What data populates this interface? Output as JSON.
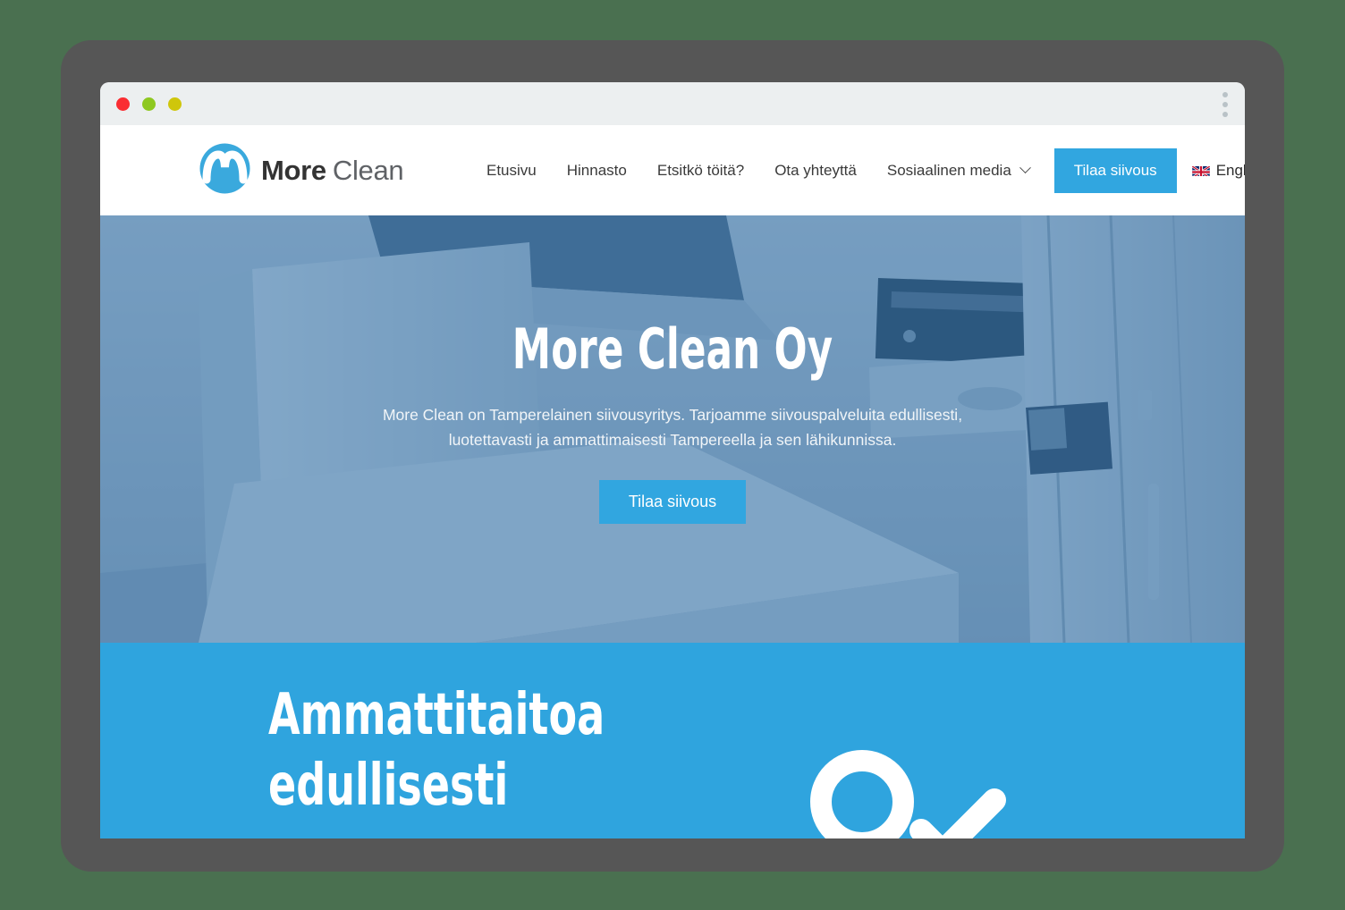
{
  "window": {
    "traffic_lights": [
      "close-red",
      "minimize-green",
      "maximize-yellow"
    ],
    "menu_icon": "kebab-menu-icon"
  },
  "header": {
    "logo": {
      "mark": "more-clean-logo-mark",
      "word_one": "More",
      "word_two": "Clean"
    },
    "nav_items": [
      {
        "label": "Etusivu",
        "has_dropdown": false
      },
      {
        "label": "Hinnasto",
        "has_dropdown": false
      },
      {
        "label": "Etsitkö töitä?",
        "has_dropdown": false
      },
      {
        "label": "Ota yhteyttä",
        "has_dropdown": false
      },
      {
        "label": "Sosiaalinen media",
        "has_dropdown": true
      }
    ],
    "cta_label": "Tilaa siivous",
    "language": {
      "label": "English",
      "flag": "uk-flag-icon"
    }
  },
  "hero": {
    "title": "More Clean Oy",
    "subtitle": "More Clean on Tamperelainen siivousyritys. Tarjoamme siivouspalveluita edullisesti, luotettavasti ja ammattimaisesti Tampereella ja sen lähikunnissa.",
    "button_label": "Tilaa siivous",
    "background_image": "kitchen-interior-photo",
    "overlay_color": "#2e6ea6"
  },
  "promo": {
    "title": "Ammattitaitoa\nedullisesti",
    "background_color": "#2fa4de",
    "decoration_icons": [
      "circle-outline-icon",
      "checkmark-icon"
    ]
  },
  "floating": {
    "whatsapp": {
      "label": "whatsapp-icon",
      "color": "#25d366"
    }
  },
  "colors": {
    "page_background": "#4a7050",
    "device_frame": "#565656",
    "accent_blue": "#31a6e0",
    "promo_blue": "#2fa4de",
    "chrome_bar": "#eceff0"
  }
}
